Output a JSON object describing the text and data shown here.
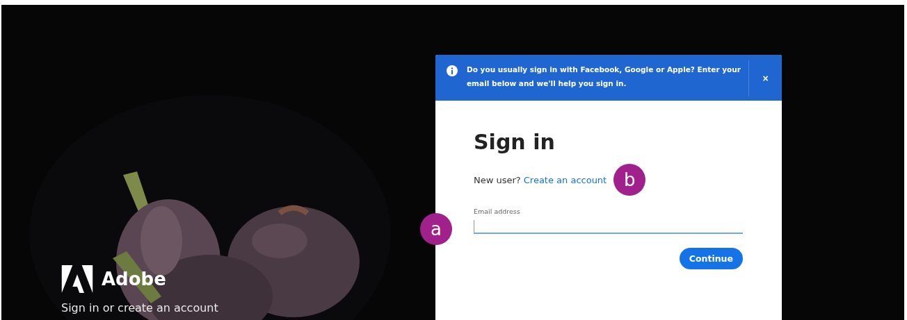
{
  "brand": {
    "name": "Adobe",
    "tagline": "Sign in or create an account"
  },
  "dialog": {
    "banner": {
      "text": "Do you usually sign in with Facebook, Google or Apple? Enter your email below and we'll help you sign in.",
      "close": "×"
    },
    "title": "Sign in",
    "prompt": "New user?",
    "link": "Create an account",
    "email": {
      "label": "Email address"
    },
    "button": "Continue"
  },
  "callouts": [
    {
      "kind": "link",
      "label": "b"
    },
    {
      "kind": "field",
      "label": "a"
    }
  ]
}
